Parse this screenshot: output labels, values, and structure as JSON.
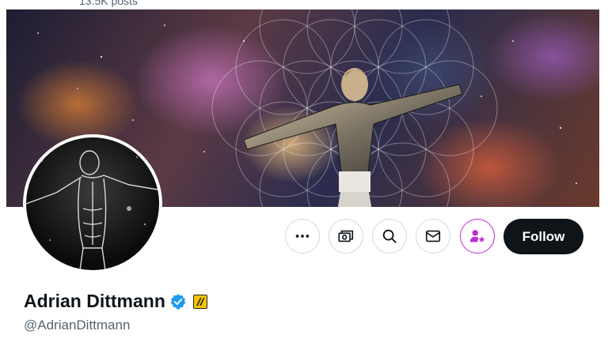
{
  "header": {
    "posts_count": "13.5K posts"
  },
  "profile": {
    "display_name": "Adrian Dittmann",
    "handle": "@AdrianDittmann",
    "verified": true,
    "verified_color": "#1d9bf0",
    "affiliate_badge_color": "#f4c400"
  },
  "actions": {
    "more_icon": "more-horizontal-icon",
    "subscribe_icon": "subscriptions-icon",
    "search_icon": "search-icon",
    "message_icon": "mail-icon",
    "subscribe_star_icon": "person-star-icon",
    "subscribe_star_color": "#c02ad8",
    "follow_label": "Follow"
  },
  "colors": {
    "text_primary": "#0f1419",
    "text_secondary": "#536471",
    "follow_bg": "#0f1419",
    "border": "#cfd9de"
  }
}
